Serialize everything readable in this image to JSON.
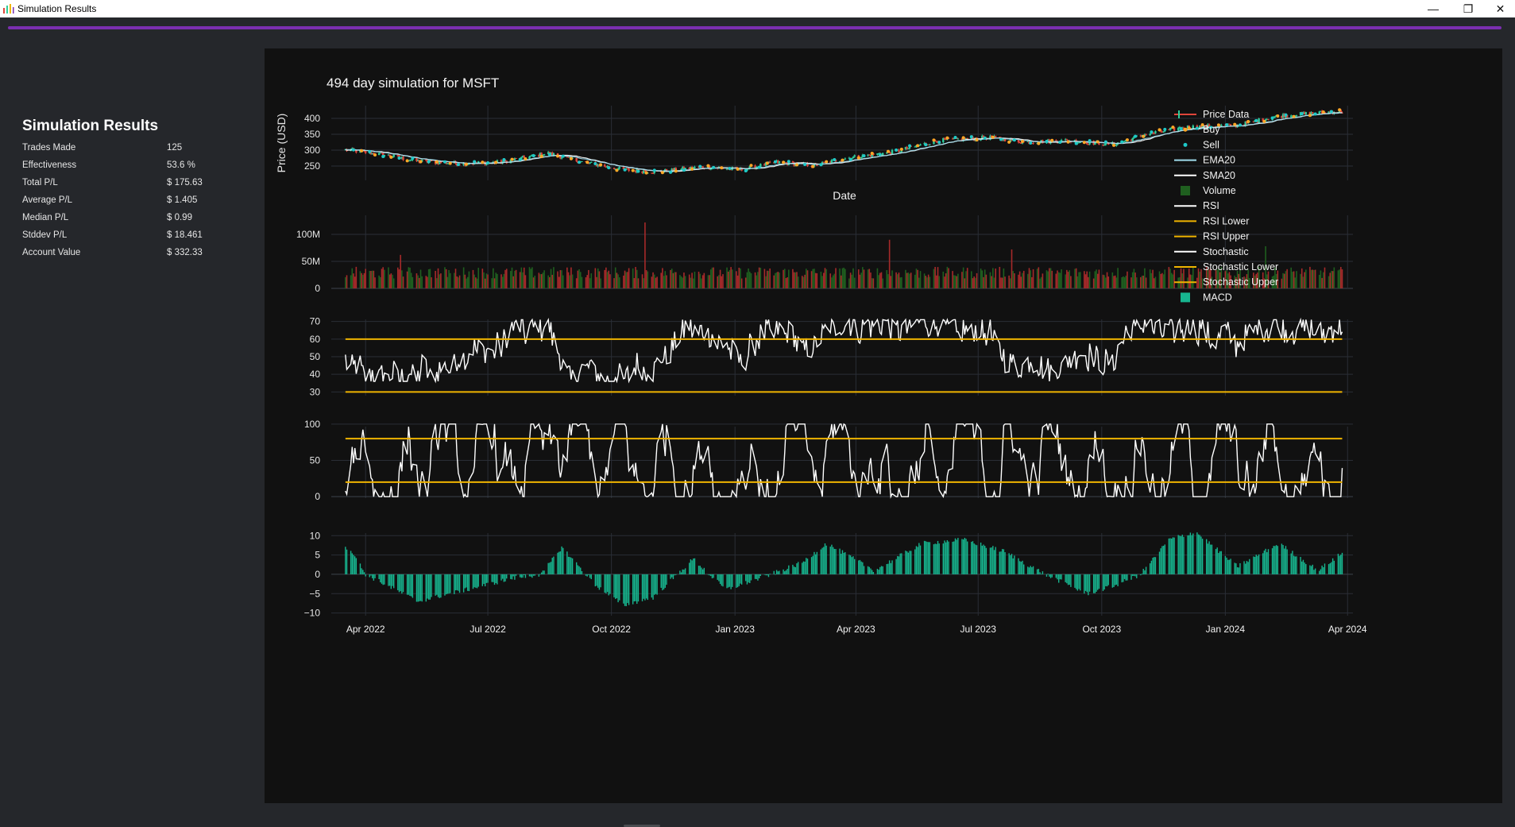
{
  "window": {
    "title": "Simulation Results",
    "controls": {
      "minimize": "—",
      "restore": "❐",
      "close": "✕"
    }
  },
  "colors": {
    "accent": "#7b2fb0",
    "up": "#2ecc9a",
    "down": "#e0453a",
    "buy": "#ffa726",
    "sell": "#1ec8c8",
    "ema": "#9fdcec",
    "sma": "#ffffff",
    "rsi": "#ffffff",
    "bands": "#f0b400",
    "volume_up": "#1f5f1f",
    "volume_down": "#a62a2a",
    "macd": "#17b58f"
  },
  "sidebar": {
    "heading": "Simulation Results",
    "stats": [
      {
        "label": "Trades Made",
        "value": "125"
      },
      {
        "label": "Effectiveness",
        "value": "53.6 %"
      },
      {
        "label": "Total P/L",
        "value": "$ 175.63"
      },
      {
        "label": "Average P/L",
        "value": "$ 1.405"
      },
      {
        "label": "Median P/L",
        "value": "$ 0.99"
      },
      {
        "label": "Stddev P/L",
        "value": "$ 18.461"
      },
      {
        "label": "Account Value",
        "value": "$ 332.33"
      }
    ]
  },
  "chart_data": {
    "type": "line",
    "title": "494 day simulation for MSFT",
    "xlabel": "Date",
    "x_range": [
      "2022-03-10",
      "2024-04-05"
    ],
    "x_ticks": [
      "Apr 2022",
      "Jul 2022",
      "Oct 2022",
      "Jan 2023",
      "Apr 2023",
      "Jul 2023",
      "Oct 2023",
      "Jan 2024",
      "Apr 2024"
    ],
    "x_tick_dates": [
      "2022-04-01",
      "2022-07-01",
      "2022-10-01",
      "2023-01-01",
      "2023-04-01",
      "2023-07-01",
      "2023-10-01",
      "2024-01-01",
      "2024-04-01"
    ],
    "grid": true,
    "legend": "right",
    "legend_items": [
      {
        "label": "Price Data",
        "kind": "candle"
      },
      {
        "label": "Buy",
        "kind": "dot",
        "color": "#ffa726"
      },
      {
        "label": "Sell",
        "kind": "dot",
        "color": "#1ec8c8"
      },
      {
        "label": "EMA20",
        "kind": "line",
        "color": "#9fdcec"
      },
      {
        "label": "SMA20",
        "kind": "line",
        "color": "#ffffff"
      },
      {
        "label": "Volume",
        "kind": "square",
        "color": "#1f5f1f"
      },
      {
        "label": "RSI",
        "kind": "line",
        "color": "#ffffff"
      },
      {
        "label": "RSI Lower",
        "kind": "line",
        "color": "#f0b400"
      },
      {
        "label": "RSI Upper",
        "kind": "line",
        "color": "#f0b400"
      },
      {
        "label": "Stochastic",
        "kind": "line",
        "color": "#ffffff"
      },
      {
        "label": "Stochastic Lower",
        "kind": "line",
        "color": "#f0b400"
      },
      {
        "label": "Stochastic Upper",
        "kind": "line",
        "color": "#f0b400"
      },
      {
        "label": "MACD",
        "kind": "square",
        "color": "#17b58f"
      }
    ],
    "panels": [
      {
        "id": "price",
        "ylabel": "Price (USD)",
        "ylim": [
          205,
          440
        ],
        "yticks": [
          250,
          300,
          350,
          400
        ],
        "ytick_labels": [
          "250",
          "300",
          "350",
          "400"
        ],
        "series_keypoints": {
          "name": "Price Data",
          "x": [
            "2022-03-20",
            "2022-04-15",
            "2022-05-10",
            "2022-06-10",
            "2022-07-10",
            "2022-08-15",
            "2022-09-10",
            "2022-10-10",
            "2022-11-05",
            "2022-12-10",
            "2023-01-05",
            "2023-02-01",
            "2023-03-01",
            "2023-03-25",
            "2023-04-30",
            "2023-06-01",
            "2023-07-10",
            "2023-08-05",
            "2023-09-05",
            "2023-10-10",
            "2023-11-01",
            "2023-12-01",
            "2024-01-10",
            "2024-02-10",
            "2024-03-25"
          ],
          "y": [
            300,
            285,
            265,
            258,
            262,
            290,
            262,
            238,
            232,
            248,
            238,
            262,
            252,
            275,
            295,
            330,
            340,
            325,
            330,
            318,
            348,
            372,
            378,
            408,
            422
          ]
        }
      },
      {
        "id": "volume",
        "ylim": [
          0,
          125000000
        ],
        "yticks": [
          0,
          50000000,
          100000000
        ],
        "ytick_labels": [
          "0",
          "50M",
          "100M"
        ]
      },
      {
        "id": "rsi",
        "ylim": [
          27,
          73
        ],
        "yticks": [
          30,
          40,
          50,
          60,
          70
        ],
        "ytick_labels": [
          "30",
          "40",
          "50",
          "60",
          "70"
        ],
        "bands": [
          30,
          60
        ]
      },
      {
        "id": "stochastic",
        "ylim": [
          -2,
          102
        ],
        "yticks": [
          0,
          50,
          100
        ],
        "ytick_labels": [
          "0",
          "50",
          "100"
        ],
        "bands": [
          20,
          80
        ]
      },
      {
        "id": "macd",
        "ylim": [
          -10.5,
          11.5
        ],
        "yticks": [
          -10,
          -5,
          0,
          5,
          10
        ],
        "ytick_labels": [
          "−10",
          "−5",
          "0",
          "5",
          "10"
        ],
        "series_keypoints": {
          "name": "MACD",
          "x": [
            "2022-03-20",
            "2022-04-01",
            "2022-05-10",
            "2022-06-15",
            "2022-07-20",
            "2022-08-10",
            "2022-08-25",
            "2022-09-20",
            "2022-10-10",
            "2022-11-01",
            "2022-12-01",
            "2022-12-25",
            "2023-01-20",
            "2023-02-20",
            "2023-03-10",
            "2023-04-15",
            "2023-05-20",
            "2023-06-20",
            "2023-07-20",
            "2023-08-20",
            "2023-09-20",
            "2023-10-10",
            "2023-10-30",
            "2023-11-20",
            "2023-12-10",
            "2024-01-10",
            "2024-02-10",
            "2024-03-10",
            "2024-03-30"
          ],
          "y": [
            7,
            0,
            -7,
            -4,
            -1,
            0,
            7,
            -3,
            -8,
            -6,
            4,
            -4,
            -1,
            3,
            8,
            1,
            8,
            9,
            6,
            0,
            -5,
            -3,
            0,
            9,
            11,
            2,
            8,
            1,
            6
          ]
        }
      }
    ],
    "volume_peaks": [
      {
        "x": "2022-04-27",
        "y": 62000000
      },
      {
        "x": "2022-10-26",
        "y": 122000000
      },
      {
        "x": "2023-04-26",
        "y": 90000000
      },
      {
        "x": "2023-07-26",
        "y": 72000000
      },
      {
        "x": "2024-01-31",
        "y": 78000000
      }
    ]
  }
}
